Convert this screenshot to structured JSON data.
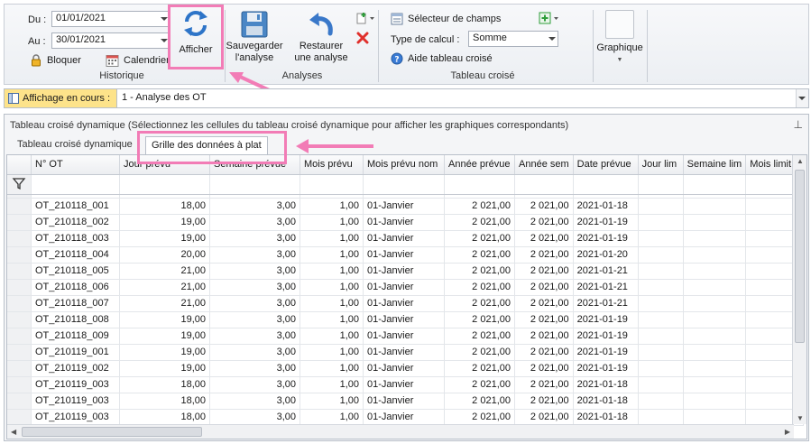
{
  "ribbon": {
    "historique": {
      "du_label": "Du :",
      "du_value": "01/01/2021",
      "au_label": "Au :",
      "au_value": "30/01/2021",
      "bloquer_label": "Bloquer",
      "calendrier_label": "Calendrier",
      "group_label": "Historique"
    },
    "afficher": {
      "label": "Afficher"
    },
    "analyses": {
      "sauvegarder_line1": "Sauvegarder",
      "sauvegarder_line2": "l'analyse",
      "restaurer_line1": "Restaurer",
      "restaurer_line2": "une analyse",
      "group_label": "Analyses"
    },
    "tableau_croise": {
      "selecteur_label": "Sélecteur de champs",
      "type_calcul_label": "Type de calcul :",
      "type_calcul_value": "Somme",
      "aide_label": "Aide tableau croisé",
      "group_label": "Tableau croisé"
    },
    "graphique": {
      "label": "Graphique"
    }
  },
  "affichage": {
    "label": "Affichage en cours :",
    "value": "1 - Analyse des OT"
  },
  "panel": {
    "title": "Tableau croisé dynamique (Sélectionnez les cellules du tableau croisé dynamique pour afficher les graphiques correspondants)",
    "tabs": [
      {
        "label": "Tableau croisé dynamique"
      },
      {
        "label": "Grille des données à plat"
      }
    ]
  },
  "grid": {
    "columns": [
      "N° OT",
      "Jour prévu",
      "Semaine prévue",
      "Mois prévu",
      "Mois prévu nom",
      "Année prévue",
      "Année sem",
      "Date prévue",
      "Jour lim",
      "Semaine lim",
      "Mois limit"
    ],
    "rows": [
      [
        "OT_210118_001",
        "18,00",
        "3,00",
        "1,00",
        "01-Janvier",
        "2 021,00",
        "2 021,00",
        "2021-01-18"
      ],
      [
        "OT_210118_002",
        "19,00",
        "3,00",
        "1,00",
        "01-Janvier",
        "2 021,00",
        "2 021,00",
        "2021-01-19"
      ],
      [
        "OT_210118_003",
        "19,00",
        "3,00",
        "1,00",
        "01-Janvier",
        "2 021,00",
        "2 021,00",
        "2021-01-19"
      ],
      [
        "OT_210118_004",
        "20,00",
        "3,00",
        "1,00",
        "01-Janvier",
        "2 021,00",
        "2 021,00",
        "2021-01-20"
      ],
      [
        "OT_210118_005",
        "21,00",
        "3,00",
        "1,00",
        "01-Janvier",
        "2 021,00",
        "2 021,00",
        "2021-01-21"
      ],
      [
        "OT_210118_006",
        "21,00",
        "3,00",
        "1,00",
        "01-Janvier",
        "2 021,00",
        "2 021,00",
        "2021-01-21"
      ],
      [
        "OT_210118_007",
        "21,00",
        "3,00",
        "1,00",
        "01-Janvier",
        "2 021,00",
        "2 021,00",
        "2021-01-21"
      ],
      [
        "OT_210118_008",
        "19,00",
        "3,00",
        "1,00",
        "01-Janvier",
        "2 021,00",
        "2 021,00",
        "2021-01-19"
      ],
      [
        "OT_210118_009",
        "19,00",
        "3,00",
        "1,00",
        "01-Janvier",
        "2 021,00",
        "2 021,00",
        "2021-01-19"
      ],
      [
        "OT_210119_001",
        "19,00",
        "3,00",
        "1,00",
        "01-Janvier",
        "2 021,00",
        "2 021,00",
        "2021-01-19"
      ],
      [
        "OT_210119_002",
        "19,00",
        "3,00",
        "1,00",
        "01-Janvier",
        "2 021,00",
        "2 021,00",
        "2021-01-19"
      ],
      [
        "OT_210119_003",
        "18,00",
        "3,00",
        "1,00",
        "01-Janvier",
        "2 021,00",
        "2 021,00",
        "2021-01-18"
      ],
      [
        "OT_210119_003",
        "18,00",
        "3,00",
        "1,00",
        "01-Janvier",
        "2 021,00",
        "2 021,00",
        "2021-01-18"
      ],
      [
        "OT_210119_003",
        "18,00",
        "3,00",
        "1,00",
        "01-Janvier",
        "2 021,00",
        "2 021,00",
        "2021-01-18"
      ]
    ]
  },
  "colors": {
    "highlight": "#f27cb6",
    "affichage_bg": "#fde38a",
    "refresh_blue": "#2d74c8",
    "delete_red": "#e0302c"
  }
}
